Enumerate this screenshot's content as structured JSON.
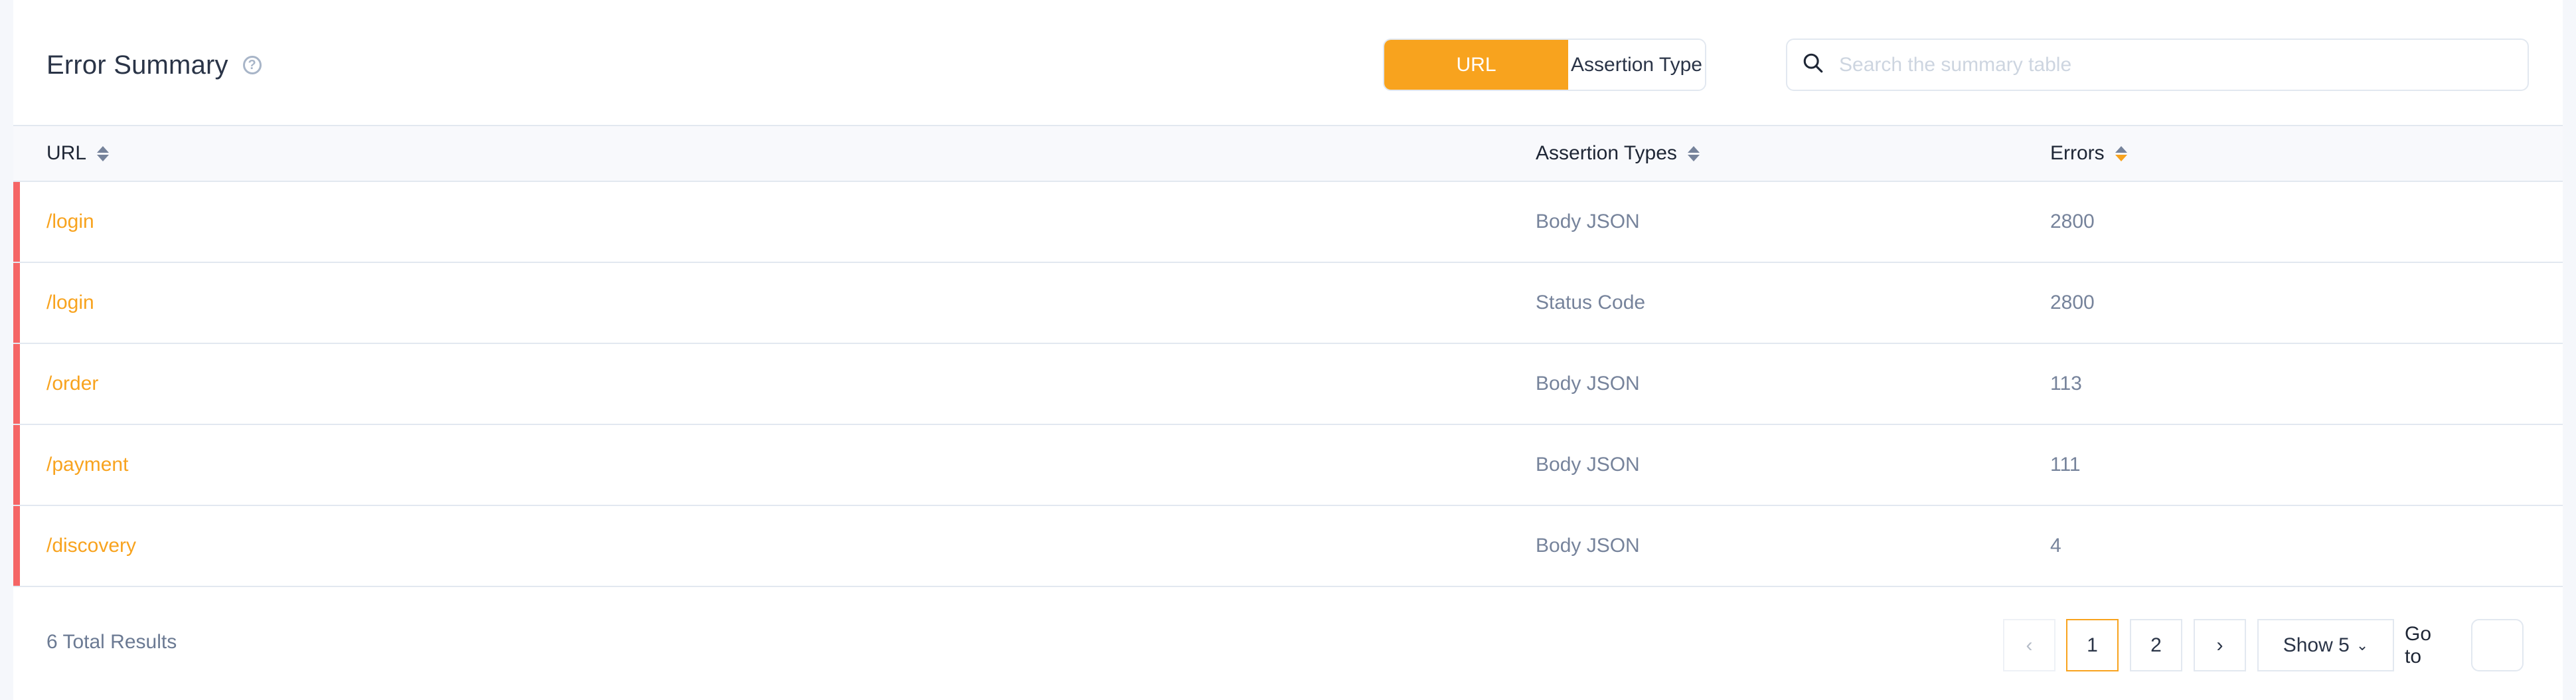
{
  "header": {
    "title": "Error Summary",
    "help_icon": "question-circle-icon",
    "group_by": {
      "options": [
        "URL",
        "Assertion Type"
      ],
      "selected": "URL"
    },
    "search": {
      "placeholder": "Search the summary table",
      "value": "",
      "icon": "search-icon"
    }
  },
  "table": {
    "columns": [
      {
        "label": "URL",
        "sort": "none"
      },
      {
        "label": "Assertion Types",
        "sort": "none"
      },
      {
        "label": "Errors",
        "sort": "descending"
      }
    ],
    "rows": [
      {
        "url": "/login",
        "assertion_type": "Body JSON",
        "errors": "2800"
      },
      {
        "url": "/login",
        "assertion_type": "Status Code",
        "errors": "2800"
      },
      {
        "url": "/order",
        "assertion_type": "Body JSON",
        "errors": "113"
      },
      {
        "url": "/payment",
        "assertion_type": "Body JSON",
        "errors": "111"
      },
      {
        "url": "/discovery",
        "assertion_type": "Body JSON",
        "errors": "4"
      }
    ]
  },
  "footer": {
    "total": "6 Total Results",
    "pagination": {
      "prev": "‹",
      "pages": [
        "1",
        "2"
      ],
      "current": "1",
      "next": "›",
      "show_label": "Show 5",
      "goto_label": "Go to",
      "goto_value": ""
    }
  },
  "colors": {
    "accent": "#f8a31e",
    "error_bar": "#f56565",
    "muted_text": "#76839b",
    "border": "#e2e8f0"
  }
}
